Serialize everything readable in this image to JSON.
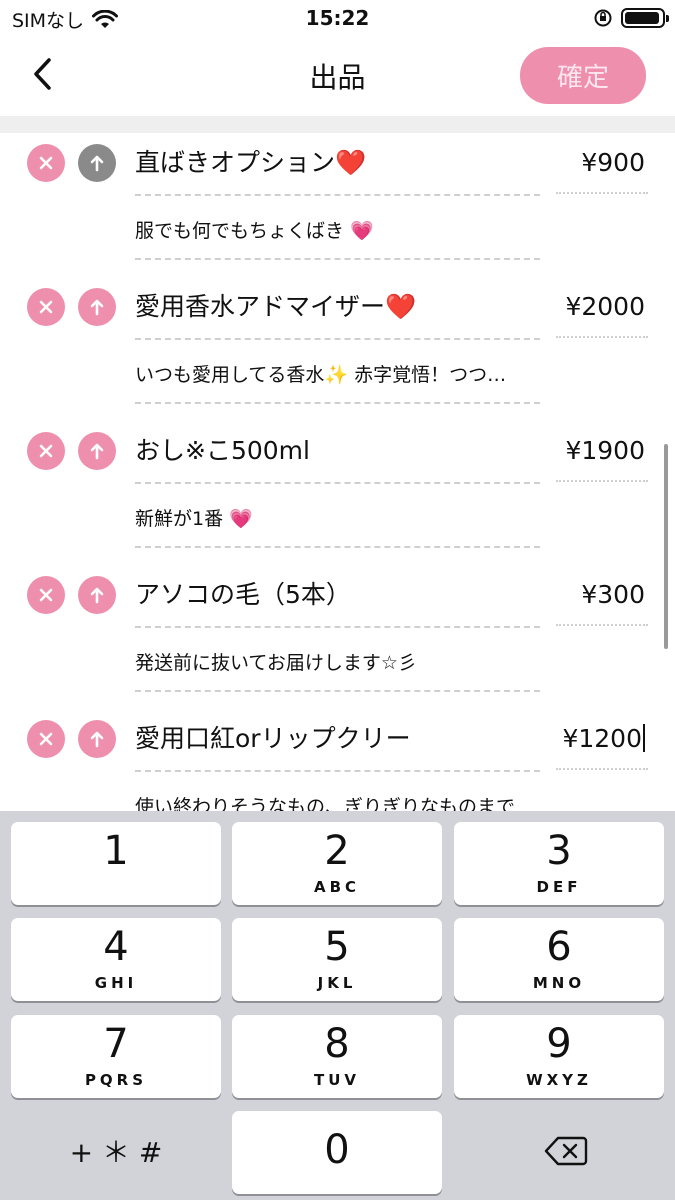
{
  "status": {
    "carrier": "SIMなし",
    "time": "15:22"
  },
  "nav": {
    "title": "出品",
    "confirm_label": "確定"
  },
  "items": [
    {
      "title": "直ばきオプション",
      "title_emoji": "❤️",
      "price": "¥900",
      "desc": "服でも何でもちょくばき",
      "desc_emoji": "💗",
      "up_disabled": true
    },
    {
      "title": "愛用香水アドマイザー",
      "title_emoji": "❤️",
      "price": "¥2000",
      "desc": "いつも愛用してる香水",
      "desc_emoji": "✨",
      "desc_tail": "赤字覚悟！つつ…",
      "up_disabled": false
    },
    {
      "title": "おし※こ500ml",
      "price": "¥1900",
      "desc": "新鮮が1番",
      "desc_emoji": "💗",
      "up_disabled": false
    },
    {
      "title": "アソコの毛（5本）",
      "price": "¥300",
      "desc": "発送前に抜いてお届けします☆彡",
      "up_disabled": false
    },
    {
      "title": "愛用口紅orリップクリー",
      "price": "¥1200",
      "desc": "使い終わりそうなもの、ぎりぎりなものまで",
      "up_disabled": false,
      "editing": true
    }
  ],
  "keypad": {
    "keys": [
      {
        "digit": "1",
        "letters": ""
      },
      {
        "digit": "2",
        "letters": "ABC"
      },
      {
        "digit": "3",
        "letters": "DEF"
      },
      {
        "digit": "4",
        "letters": "GHI"
      },
      {
        "digit": "5",
        "letters": "JKL"
      },
      {
        "digit": "6",
        "letters": "MNO"
      },
      {
        "digit": "7",
        "letters": "PQRS"
      },
      {
        "digit": "8",
        "letters": "TUV"
      },
      {
        "digit": "9",
        "letters": "WXYZ"
      }
    ],
    "symbols_label": "+ ＊ #",
    "zero": "0"
  },
  "colors": {
    "accent": "#ef8fae",
    "disabled": "#8a8a8a",
    "keypad_bg": "#d1d3d9"
  },
  "icons": [
    "wifi-icon",
    "orientation-lock-icon",
    "battery-icon",
    "back-chevron-icon",
    "remove-icon",
    "arrow-up-icon",
    "backspace-icon"
  ]
}
